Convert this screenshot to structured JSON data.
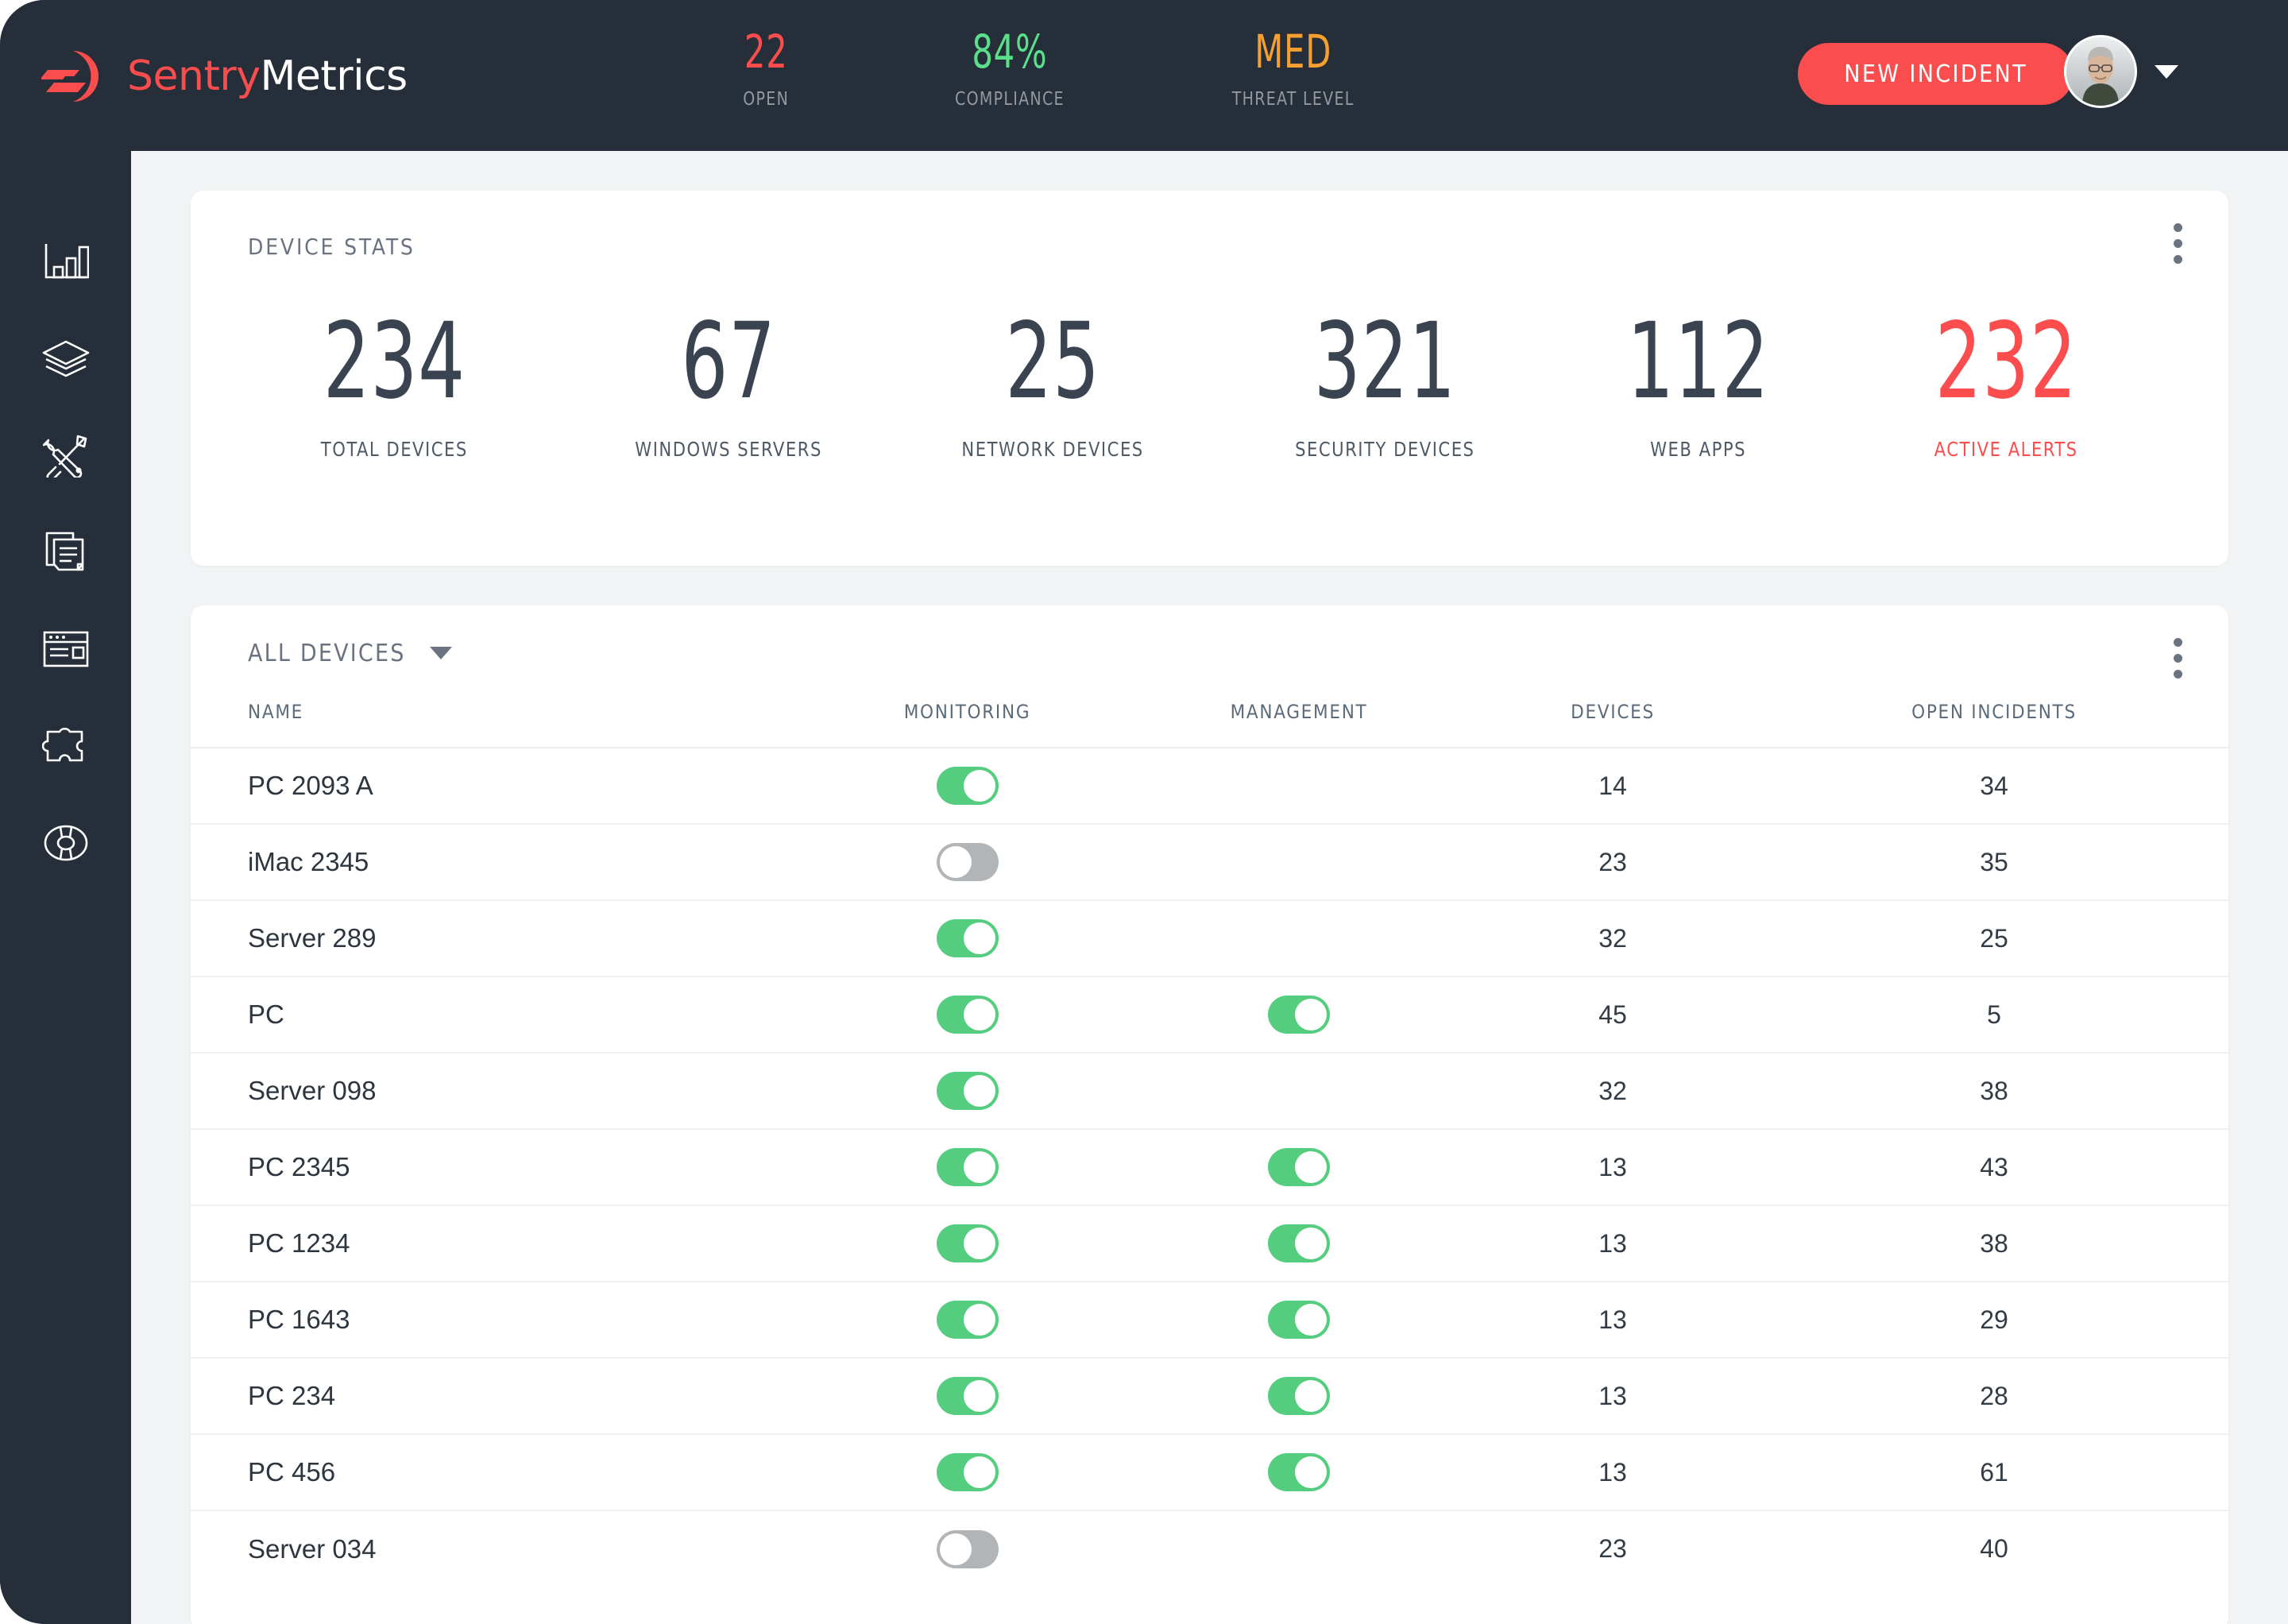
{
  "brand": {
    "name_part1": "Sentry",
    "name_part2": "Metrics"
  },
  "header": {
    "stats": [
      {
        "value": "22",
        "label": "OPEN",
        "color": "#fb4d4d"
      },
      {
        "value": "84%",
        "label": "COMPLIANCE",
        "color": "#5ae08a"
      },
      {
        "value": "MED",
        "label": "THREAT LEVEL",
        "color": "#f5a030"
      }
    ],
    "new_incident_label": "NEW INCIDENT"
  },
  "sidebar": {
    "items": [
      {
        "icon": "bar-chart-icon"
      },
      {
        "icon": "layers-icon"
      },
      {
        "icon": "tools-icon"
      },
      {
        "icon": "documents-icon"
      },
      {
        "icon": "browser-window-icon"
      },
      {
        "icon": "puzzle-piece-icon"
      },
      {
        "icon": "lifebuoy-icon"
      }
    ]
  },
  "device_stats": {
    "title": "DEVICE STATS",
    "items": [
      {
        "value": "234",
        "label": "TOTAL DEVICES",
        "alert": false
      },
      {
        "value": "67",
        "label": "WINDOWS SERVERS",
        "alert": false
      },
      {
        "value": "25",
        "label": "NETWORK DEVICES",
        "alert": false
      },
      {
        "value": "321",
        "label": "SECURITY DEVICES",
        "alert": false
      },
      {
        "value": "112",
        "label": "WEB APPS",
        "alert": false
      },
      {
        "value": "232",
        "label": "ACTIVE ALERTS",
        "alert": true
      }
    ]
  },
  "devices_table": {
    "filter_label": "ALL DEVICES",
    "columns": [
      "NAME",
      "MONITORING",
      "MANAGEMENT",
      "DEVICES",
      "OPEN INCIDENTS"
    ],
    "rows": [
      {
        "name": "PC 2093 A",
        "monitoring": "on",
        "management": "none",
        "devices": "14",
        "open_incidents": "34"
      },
      {
        "name": "iMac 2345",
        "monitoring": "off",
        "management": "none",
        "devices": "23",
        "open_incidents": "35"
      },
      {
        "name": "Server 289",
        "monitoring": "on",
        "management": "none",
        "devices": "32",
        "open_incidents": "25"
      },
      {
        "name": "PC",
        "monitoring": "on",
        "management": "on",
        "devices": "45",
        "open_incidents": "5"
      },
      {
        "name": "Server 098",
        "monitoring": "on",
        "management": "none",
        "devices": "32",
        "open_incidents": "38"
      },
      {
        "name": "PC 2345",
        "monitoring": "on",
        "management": "on",
        "devices": "13",
        "open_incidents": "43"
      },
      {
        "name": "PC 1234",
        "monitoring": "on",
        "management": "on",
        "devices": "13",
        "open_incidents": "38"
      },
      {
        "name": "PC 1643",
        "monitoring": "on",
        "management": "on",
        "devices": "13",
        "open_incidents": "29"
      },
      {
        "name": "PC 234",
        "monitoring": "on",
        "management": "on",
        "devices": "13",
        "open_incidents": "28"
      },
      {
        "name": "PC 456",
        "monitoring": "on",
        "management": "on",
        "devices": "13",
        "open_incidents": "61"
      },
      {
        "name": "Server 034",
        "monitoring": "off",
        "management": "none",
        "devices": "23",
        "open_incidents": "40"
      }
    ]
  },
  "colors": {
    "brand_red": "#fb4d4d",
    "toggle_on": "#54ce7e",
    "toggle_off": "#b2b5b8",
    "dark_bg": "#262e3a",
    "page_bg": "#f2f3f4"
  }
}
